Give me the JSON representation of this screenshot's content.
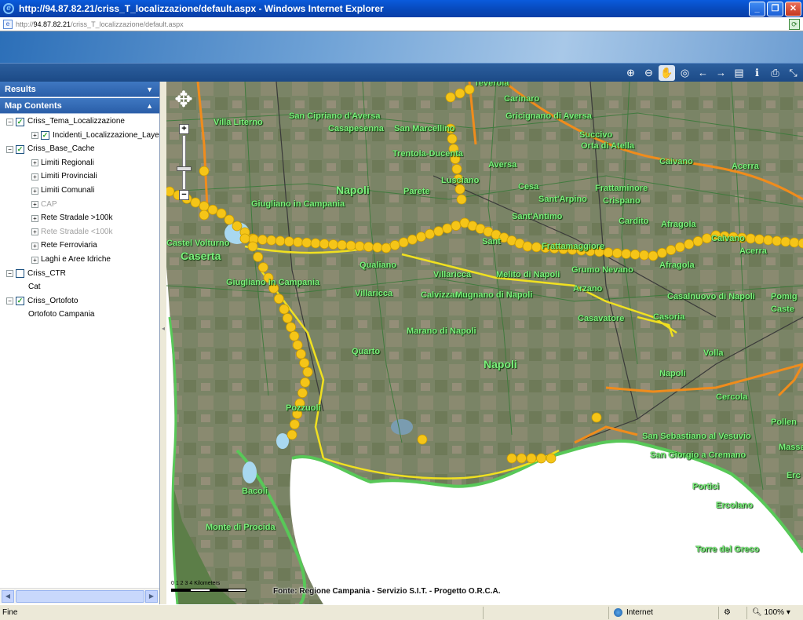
{
  "window": {
    "title": "http://94.87.82.21/criss_T_localizzazione/default.aspx - Windows Internet Explorer",
    "minimize_glyph": "_",
    "maximize_glyph": "❐",
    "close_glyph": "✕"
  },
  "address": {
    "prefix": "http://",
    "host": "94.87.82.21",
    "path": "/criss_T_localizzazione/default.aspx"
  },
  "toolbar": {
    "tools": [
      {
        "name": "zoom-in-icon",
        "glyph": "⊕"
      },
      {
        "name": "zoom-out-icon",
        "glyph": "⊖"
      },
      {
        "name": "pan-hand-icon",
        "glyph": "✋",
        "selected": true
      },
      {
        "name": "full-extent-icon",
        "glyph": "◎"
      },
      {
        "name": "back-arrow-icon",
        "glyph": "←"
      },
      {
        "name": "forward-arrow-icon",
        "glyph": "→"
      },
      {
        "name": "identify-layer-icon",
        "glyph": "▤"
      },
      {
        "name": "info-icon",
        "glyph": "ℹ"
      },
      {
        "name": "print-icon",
        "glyph": "⎙"
      },
      {
        "name": "measure-icon",
        "glyph": "⤡"
      }
    ]
  },
  "panels": {
    "results": {
      "label": "Results",
      "arrow": "▼"
    },
    "contents": {
      "label": "Map Contents",
      "arrow": "▲"
    }
  },
  "tree": [
    {
      "label": "Criss_Tema_Localizzazione",
      "level": 0,
      "expand": "⊟",
      "checked": true
    },
    {
      "label": "Incidenti_Localizzazione_Layer",
      "level": 1,
      "expand": "⊞",
      "checked": true
    },
    {
      "label": "Criss_Base_Cache",
      "level": 0,
      "expand": "⊟",
      "checked": true
    },
    {
      "label": "Limiti Regionali",
      "level": 2,
      "expand": "⊞"
    },
    {
      "label": "Limiti Provinciali",
      "level": 2,
      "expand": "⊞"
    },
    {
      "label": "Limiti Comunali",
      "level": 2,
      "expand": "⊞"
    },
    {
      "label": "CAP",
      "level": 2,
      "expand": "⊞",
      "gray": true
    },
    {
      "label": "Rete Stradale >100k",
      "level": 2,
      "expand": "⊞"
    },
    {
      "label": "Rete Stradale <100k",
      "level": 2,
      "expand": "⊞",
      "gray": true
    },
    {
      "label": "Rete Ferroviaria",
      "level": 2,
      "expand": "⊞"
    },
    {
      "label": "Laghi e Aree Idriche",
      "level": 2,
      "expand": "⊞"
    },
    {
      "label": "Criss_CTR",
      "level": 0,
      "expand": "⊟",
      "checked": false
    },
    {
      "label": "Cat",
      "level": 3
    },
    {
      "label": "Criss_Ortofoto",
      "level": 0,
      "expand": "⊟",
      "checked": true
    },
    {
      "label": "Ortofoto Campania",
      "level": 3
    }
  ],
  "map": {
    "places": [
      {
        "text": "Teverola"
      },
      {
        "text": "Carinaro"
      },
      {
        "text": "Villa Literno"
      },
      {
        "text": "San Cipriano d'Aversa"
      },
      {
        "text": "Casapesenna"
      },
      {
        "text": "San Marcellino"
      },
      {
        "text": "Gricignano di Aversa"
      },
      {
        "text": "Succivo"
      },
      {
        "text": "Orta di Atella"
      },
      {
        "text": "Trentola-Ducenta"
      },
      {
        "text": "Aversa"
      },
      {
        "text": "Lusciano"
      },
      {
        "text": "Napoli",
        "big": true
      },
      {
        "text": "Parete"
      },
      {
        "text": "Cesa"
      },
      {
        "text": "Frattaminore"
      },
      {
        "text": "Sant'Arpino"
      },
      {
        "text": "Crispano"
      },
      {
        "text": "Caivano"
      },
      {
        "text": "Acerra"
      },
      {
        "text": "Giugliano in Campania"
      },
      {
        "text": "Sant'Antimo"
      },
      {
        "text": "Cardito"
      },
      {
        "text": "Afragola"
      },
      {
        "text": "Castel Volturno"
      },
      {
        "text": "Caserta",
        "big": true
      },
      {
        "text": "Sant"
      },
      {
        "text": "Frattamaggiore"
      },
      {
        "text": "Caivano"
      },
      {
        "text": "Acerra"
      },
      {
        "text": "Qualiano"
      },
      {
        "text": "Villaricca"
      },
      {
        "text": "Melito di Napoli"
      },
      {
        "text": "Grumo Nevano"
      },
      {
        "text": "Afragola"
      },
      {
        "text": "Giugliano in Campania"
      },
      {
        "text": "Villaricca"
      },
      {
        "text": "Calvizzano"
      },
      {
        "text": "Mugnano di Napoli"
      },
      {
        "text": "Arzano"
      },
      {
        "text": "Casalnuovo di Napoli"
      },
      {
        "text": "Pomig"
      },
      {
        "text": "Casavatore"
      },
      {
        "text": "Casoria"
      },
      {
        "text": "Caste"
      },
      {
        "text": "Marano di Napoli"
      },
      {
        "text": "Quarto"
      },
      {
        "text": "Napoli",
        "big": true
      },
      {
        "text": "Volla"
      },
      {
        "text": "Napoli"
      },
      {
        "text": "Pozzuoli"
      },
      {
        "text": "Cercola"
      },
      {
        "text": "Pollen"
      },
      {
        "text": "San Sebastiano al Vesuvio"
      },
      {
        "text": "Massa"
      },
      {
        "text": "San Giorgio a Cremano"
      },
      {
        "text": "Erc"
      },
      {
        "text": "Bacoli"
      },
      {
        "text": "Portici"
      },
      {
        "text": "Monte di Procida"
      },
      {
        "text": "Ercolano"
      },
      {
        "text": "Torre del Greco"
      }
    ],
    "scale_ticks": "0    1    2    3    4 Kilometers",
    "credits": "Fonte: Regione Campania - Servizio S.I.T. - Progetto O.R.C.A.",
    "pan_glyph": "✥",
    "zoom_in_glyph": "+",
    "zoom_out_glyph": "−"
  },
  "status": {
    "message": "Fine",
    "zone": "Internet",
    "zoom": "100%",
    "security_glyph": "⚙",
    "zoom_arrow": "▾"
  },
  "colors": {
    "marker": "#f5c518",
    "road_orange": "#f08c1c",
    "road_yellow": "#f0e020",
    "boundary_green": "#58c858",
    "sea": "#ffffff"
  }
}
